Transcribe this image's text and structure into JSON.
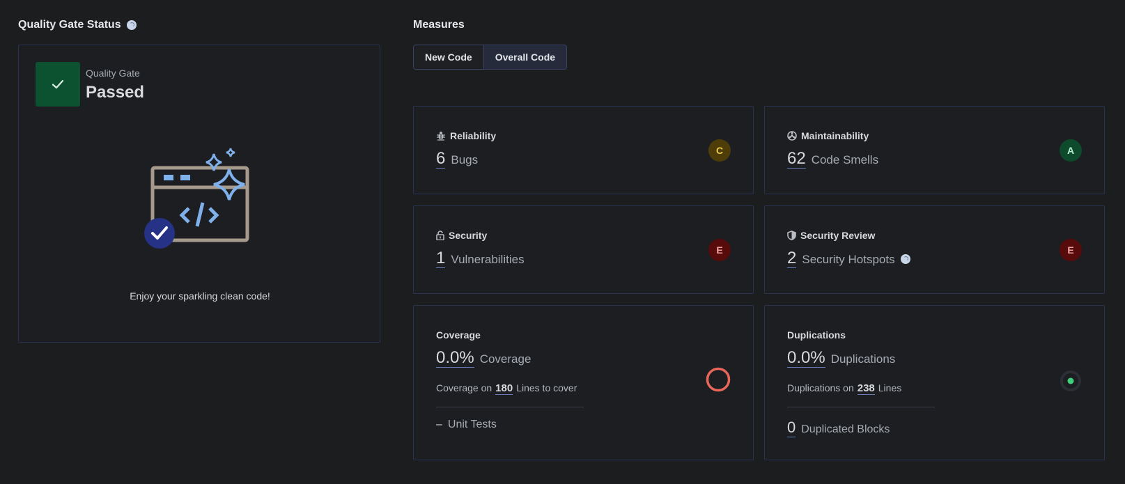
{
  "quality_gate": {
    "section_title": "Quality Gate Status",
    "label": "Quality Gate",
    "status": "Passed",
    "message": "Enjoy your sparkling clean code!"
  },
  "measures": {
    "section_title": "Measures",
    "tabs": [
      {
        "label": "New Code",
        "active": false
      },
      {
        "label": "Overall Code",
        "active": true
      }
    ],
    "reliability": {
      "title": "Reliability",
      "value": "6",
      "label": "Bugs",
      "rating": "C",
      "icon": "bug-icon"
    },
    "maintainability": {
      "title": "Maintainability",
      "value": "62",
      "label": "Code Smells",
      "rating": "A",
      "icon": "maintainability-icon"
    },
    "security": {
      "title": "Security",
      "value": "1",
      "label": "Vulnerabilities",
      "rating": "E",
      "icon": "lock-icon"
    },
    "security_review": {
      "title": "Security Review",
      "value": "2",
      "label": "Security Hotspots",
      "rating": "E",
      "icon": "shield-icon"
    },
    "coverage": {
      "title": "Coverage",
      "value": "0.0%",
      "label": "Coverage",
      "sub_prefix": "Coverage on",
      "sub_value": "180",
      "sub_suffix": "Lines to cover",
      "unit_tests_value": "–",
      "unit_tests_label": "Unit Tests"
    },
    "duplications": {
      "title": "Duplications",
      "value": "0.0%",
      "label": "Duplications",
      "sub_prefix": "Duplications on",
      "sub_value": "238",
      "sub_suffix": "Lines",
      "blocks_value": "0",
      "blocks_label": "Duplicated Blocks"
    }
  },
  "colors": {
    "passed": "#0d5230",
    "rating_c": "#4e3d09",
    "rating_a": "#0e4a2c",
    "rating_e": "#570b0b",
    "coverage_ring": "#e8675a",
    "duplication_dot": "#3ed07c"
  }
}
